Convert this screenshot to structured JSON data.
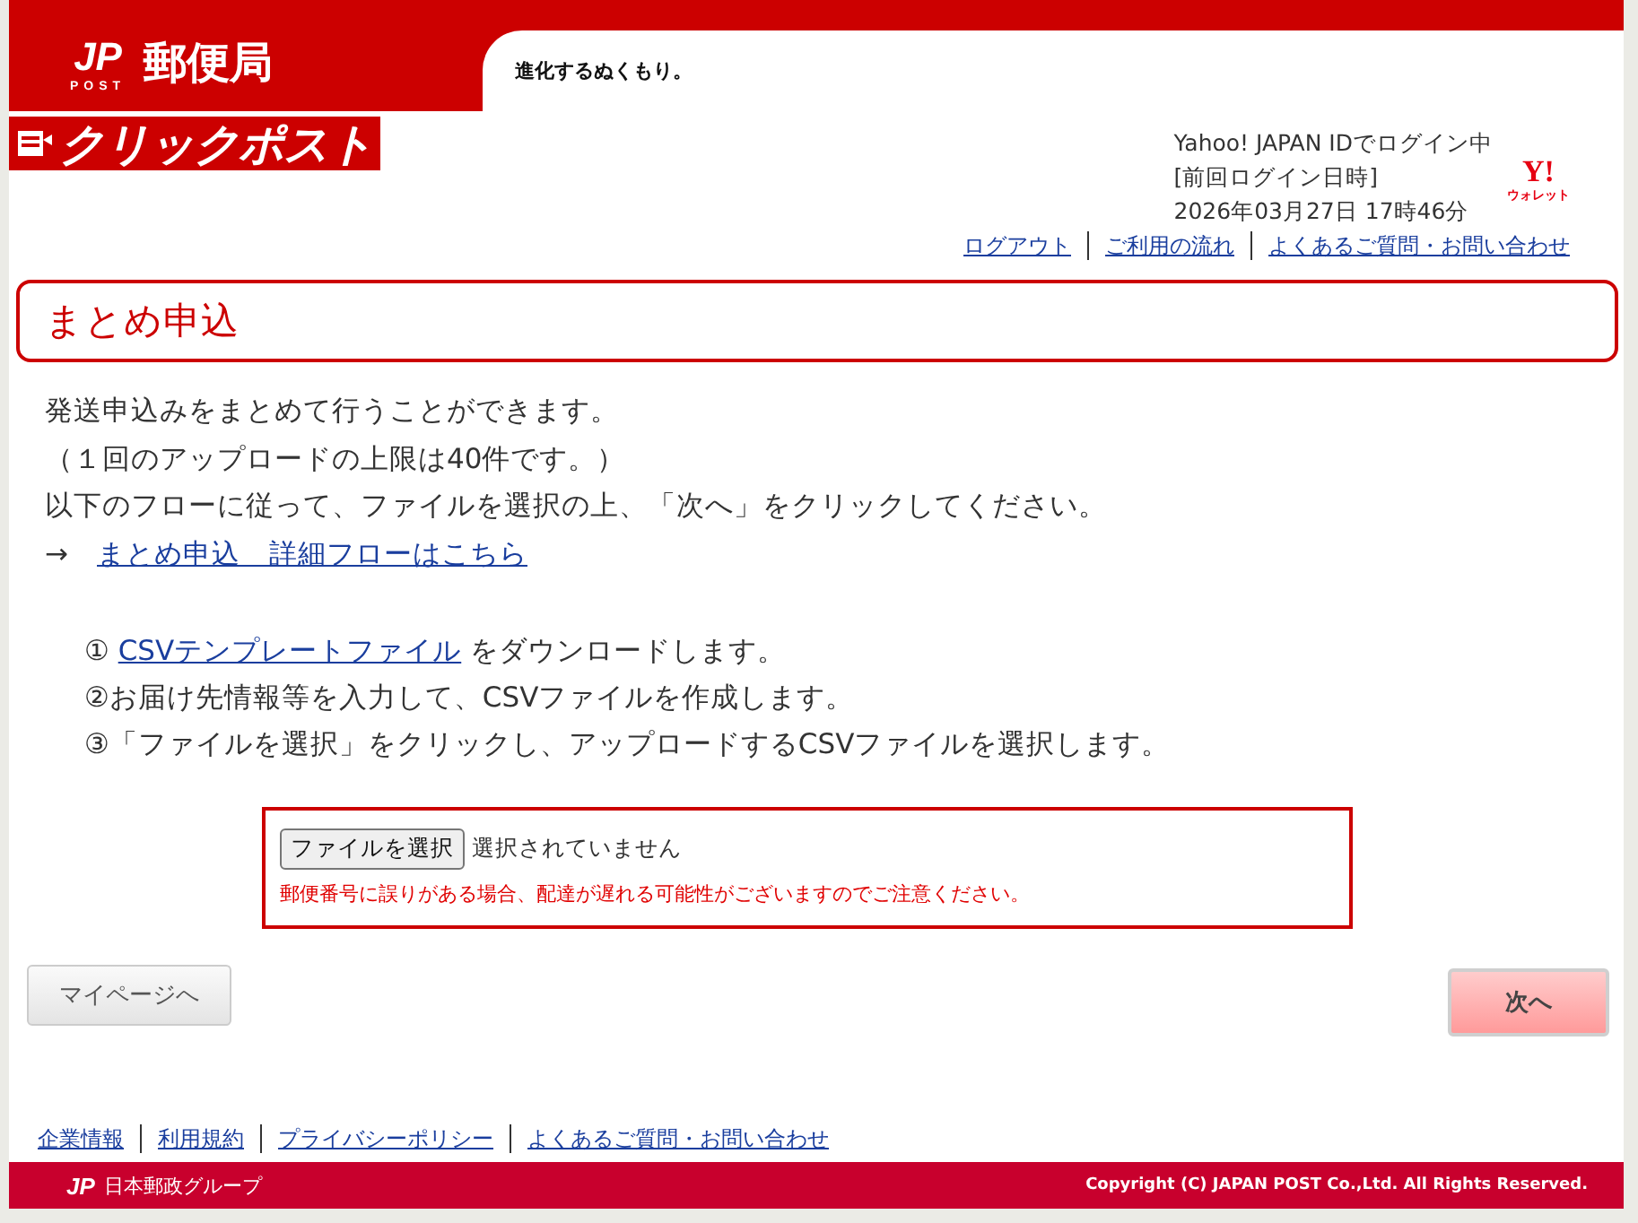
{
  "header": {
    "logo_mark": "JP",
    "logo_sub": "POST",
    "logo_name": "郵便局",
    "slogan": "進化するぬくもり。",
    "service_logo": "クリックポスト"
  },
  "user": {
    "lines": [
      "Yahoo! JAPAN IDでログイン中",
      "[前回ログイン日時]",
      "2026年03月27日 17時46分"
    ],
    "wallet_mark": "Y!",
    "wallet_label": "ウォレット"
  },
  "top_links": [
    "ログアウト",
    "ご利用の流れ",
    "よくあるご質問・お問い合わせ"
  ],
  "page_title": "まとめ申込",
  "intro": [
    "発送申込みをまとめて行うことができます。",
    "（１回のアップロードの上限は40件です。）",
    "以下のフローに従って、ファイルを選択の上、「次へ」をクリックしてください。"
  ],
  "flow_link": {
    "arrow": "→",
    "label": "まとめ申込　詳細フローはこちら"
  },
  "steps": [
    {
      "number": "①",
      "link": "CSVテンプレートファイル",
      "text": " をダウンロードします。"
    },
    {
      "number": "②",
      "text": "お届け先情報等を入力して、CSVファイルを作成します。"
    },
    {
      "number": "③",
      "text": "「ファイルを選択」をクリックし、アップロードするCSVファイルを選択します。"
    }
  ],
  "upload": {
    "button": "ファイルを選択",
    "status": "選択されていません",
    "warning": "郵便番号に誤りがある場合、配達が遅れる可能性がございますのでご注意ください。"
  },
  "buttons": {
    "back": "マイページへ",
    "next": "次へ"
  },
  "footer_links": [
    "企業情報",
    "利用規約",
    "プライバシーポリシー",
    "よくあるご質問・お問い合わせ"
  ],
  "footer": {
    "group_mark": "JP",
    "group_name": "日本郵政グループ",
    "copyright": "Copyright (C) JAPAN POST Co.,Ltd.  All Rights Reserved."
  }
}
